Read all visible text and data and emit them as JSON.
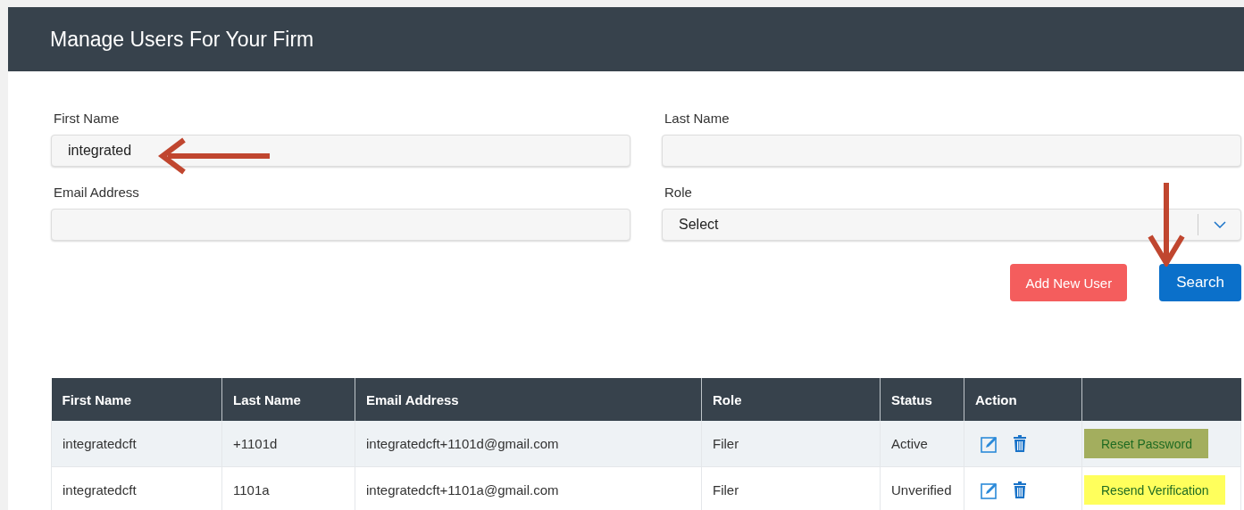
{
  "header": {
    "title": "Manage Users For Your Firm"
  },
  "form": {
    "first_name": {
      "label": "First Name",
      "value": "integrated"
    },
    "last_name": {
      "label": "Last Name"
    },
    "email": {
      "label": "Email Address"
    },
    "role": {
      "label": "Role",
      "value": "Select"
    }
  },
  "buttons": [
    {
      "label": "Add New User",
      "kind": "secondary"
    },
    {
      "label": "Search",
      "kind": "primary"
    }
  ],
  "table": {
    "columns": [
      "First Name",
      "Last Name",
      "Email Address",
      "Role",
      "Status",
      "Action"
    ],
    "rows": [
      {
        "first_name": "integratedcft",
        "last_name": "+1101d",
        "email": "integratedcft+1101d@gmail.com",
        "role": "Filer",
        "status": "Active",
        "action_link": "Reset Password",
        "color": "#a3ae5e"
      },
      {
        "first_name": "integratedcft",
        "last_name": "1101a",
        "email": "integratedcft+1101a@gmail.com",
        "role": "Filer",
        "status": "Unverified",
        "action_link": "Resend Verification",
        "color": "#ffff5c"
      }
    ]
  },
  "annotations": [
    {
      "kind": "left-arrow"
    },
    {
      "kind": "down-arrow"
    }
  ]
}
